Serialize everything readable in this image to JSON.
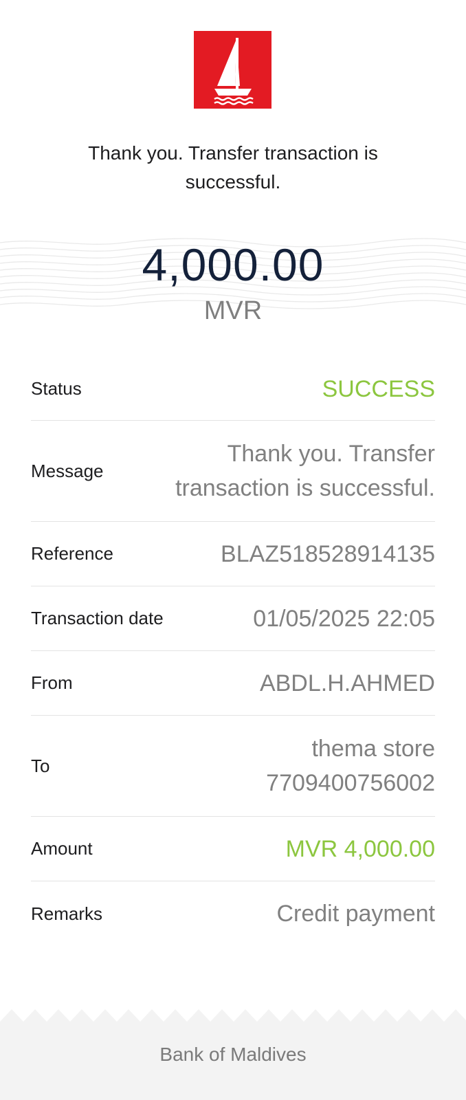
{
  "header": {
    "logo": "boat-logo-icon",
    "brand_color": "#e31b23",
    "message": "Thank you. Transfer transaction is successful."
  },
  "summary": {
    "amount": "4,000.00",
    "currency": "MVR"
  },
  "details": {
    "status_label": "Status",
    "status_value": "SUCCESS",
    "message_label": "Message",
    "message_line1": "Thank you. Transfer",
    "message_line2": "transaction is successful.",
    "reference_label": "Reference",
    "reference_value": "BLAZ518528914135",
    "date_label": "Transaction date",
    "date_value": "01/05/2025 22:05",
    "from_label": "From",
    "from_value": "ABDL.H.AHMED",
    "to_label": "To",
    "to_name": "thema store",
    "to_account": "7709400756002",
    "amount_label": "Amount",
    "amount_value": "MVR 4,000.00",
    "remarks_label": "Remarks",
    "remarks_value": "Credit payment"
  },
  "colors": {
    "success": "#8cc63f",
    "amount_text": "#14213a"
  },
  "footer": {
    "bank_name": "Bank of Maldives"
  }
}
